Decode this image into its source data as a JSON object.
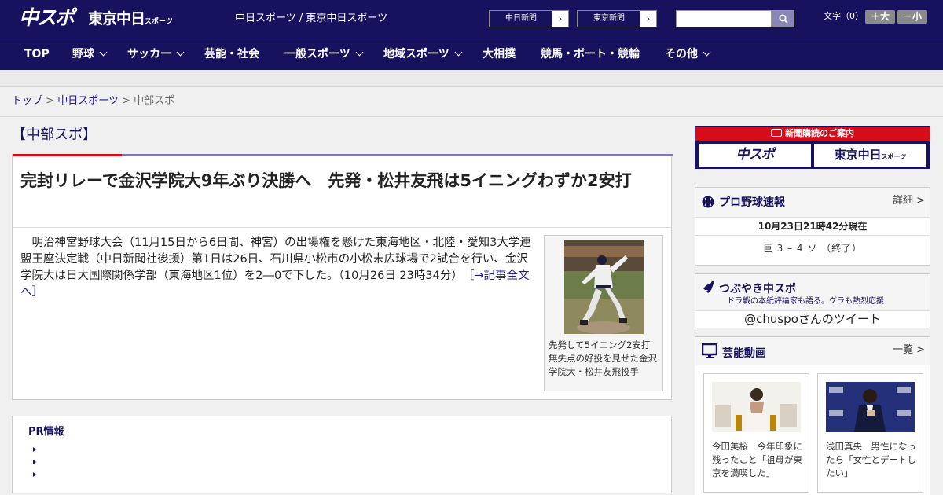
{
  "header": {
    "logo_chuspo": "中スポ",
    "logo_tokyo": "東京中日",
    "logo_tokyo_sub": "スポーツ",
    "site_links": "中日スポーツ / 東京中日スポーツ",
    "ext_links": [
      {
        "label": "中日新聞",
        "arrow": "›"
      },
      {
        "label": "東京新聞",
        "arrow": "›"
      }
    ],
    "search": {
      "value": "",
      "placeholder": ""
    },
    "font_size_label": "文字（0）",
    "font_bigger": "＋大",
    "font_smaller": "－小"
  },
  "nav": {
    "items": [
      {
        "label": "TOP",
        "dropdown": false
      },
      {
        "label": "野球",
        "dropdown": true
      },
      {
        "label": "サッカー",
        "dropdown": true
      },
      {
        "label": "芸能・社会",
        "dropdown": false
      },
      {
        "label": "一般スポーツ",
        "dropdown": true
      },
      {
        "label": "地域スポーツ",
        "dropdown": true
      },
      {
        "label": "大相撲",
        "dropdown": false
      },
      {
        "label": "競馬・ボート・競輪",
        "dropdown": false
      },
      {
        "label": "その他",
        "dropdown": true
      }
    ]
  },
  "breadcrumb": {
    "items": [
      "トップ",
      "中日スポーツ",
      "中部スポ"
    ],
    "separator": ">"
  },
  "main": {
    "section_title": "【中部スポ】",
    "headline": "完封リレーで金沢学院大9年ぶり決勝へ　先発・松井友飛は5イニングわずか2安打",
    "body": "明治神宮野球大会（11月15日から6日間、神宮）の出場権を懸けた東海地区・北陸・愛知3大学連盟王座決定戦（中日新聞社後援）第1日は26日、石川県小松市の小松末広球場で2試合を行い、金沢学院大は日大国際関係学部（東海地区1位）を2―0で下した。（10月26日 23時34分）",
    "read_more": "［→記事全文へ］",
    "photo_caption": "先発して5イニング2安打無失点の好投を見せた金沢学院大・松井友飛投手",
    "pr_title": "PR情報"
  },
  "sidebar": {
    "subscribe": {
      "banner": "新聞購読のご案内",
      "logo_chuspo": "中スポ",
      "logo_tokyo": "東京中日",
      "logo_tokyo_sub": "スポーツ"
    },
    "baseball": {
      "title": "プロ野球速報",
      "more": "詳細 >",
      "time": "10月23日21時42分現在",
      "score": "巨 3 – 4 ソ （終了）"
    },
    "twitter": {
      "title": "つぶやき中スポ",
      "subtitle": "ドラ戦の本紙評論家も語る。グラも熱烈応援",
      "link": "@chuspoさんのツイート"
    },
    "videos": {
      "title": "芸能動画",
      "more": "一覧 >",
      "items": [
        {
          "caption": "今田美桜　今年印象に残ったこと「祖母が東京を満喫した」"
        },
        {
          "caption": "浅田真央　男性になったら「女性とデートしたい」"
        }
      ]
    }
  },
  "colors": {
    "brand_navy": "#17125e",
    "accent_red": "#d70c18",
    "link_blue": "#1a1a9a"
  }
}
